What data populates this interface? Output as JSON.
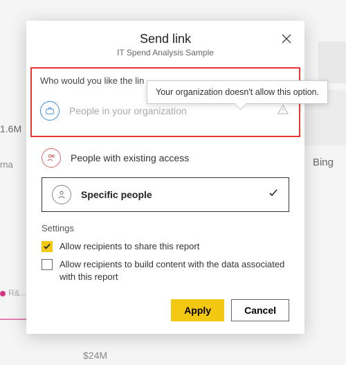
{
  "dialog": {
    "title": "Send link",
    "subtitle": "IT Spend Analysis Sample",
    "prompt": "Who would you like the lin",
    "options": {
      "org": "People in your organization",
      "existing": "People with existing access",
      "specific": "Specific people"
    },
    "tooltip": "Your organization doesn't allow this option.",
    "settings_label": "Settings",
    "cb_share": "Allow recipients to share this report",
    "cb_build": "Allow recipients to build content with the data associated with this report",
    "apply": "Apply",
    "cancel": "Cancel"
  },
  "bg": {
    "v16m": "1.6M",
    "rna": "rna",
    "bing": "Bing",
    "rd": "R&…",
    "v24m": "$24M"
  }
}
